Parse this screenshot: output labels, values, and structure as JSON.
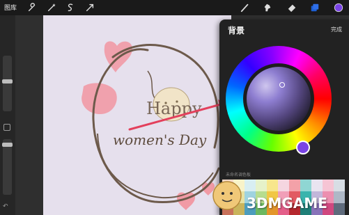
{
  "toolbar": {
    "gallery_label": "图库",
    "tools": [
      "wrench-icon",
      "wand-icon",
      "selection-icon",
      "transform-icon"
    ],
    "right_tools": [
      "brush-icon",
      "smudge-icon",
      "eraser-icon",
      "layers-icon",
      "color-icon"
    ],
    "current_color": "#7a44e6",
    "accent": "#2f6fe8"
  },
  "sidebar": {
    "undo_glyph": "↶"
  },
  "canvas": {
    "background": "#e6e0ed",
    "text_happy": "Happy",
    "text_womens": "women's Day"
  },
  "color_panel": {
    "title": "背景",
    "done_label": "完成",
    "section_label": "未命名调色板",
    "wheel_selected_hue": "#7a44e6",
    "palette": [
      "#f4d9c8",
      "#f8f3c9",
      "#d8eef2",
      "#e6f2c9",
      "#f7e68c",
      "#f5d6e0",
      "#f3a1a8",
      "#8fd6d3",
      "#e9e4f0",
      "#f6c4d4",
      "#d7dde4",
      "#e8b7a6",
      "#e7e1a2",
      "#9fd3e0",
      "#b7dd8f",
      "#f1c745",
      "#f19fb8",
      "#e25a62",
      "#39b4ad",
      "#c2b6da",
      "#ec8fb0",
      "#aeb8c6",
      "#c8715b",
      "#c9b45c",
      "#4d9dbd",
      "#6cb860",
      "#e3962b",
      "#e45f8a",
      "#b5282e",
      "#1f7f78",
      "#8873b9",
      "#d0487f",
      "#5f6b7c"
    ]
  },
  "watermark": {
    "text": "3DMGAME"
  }
}
